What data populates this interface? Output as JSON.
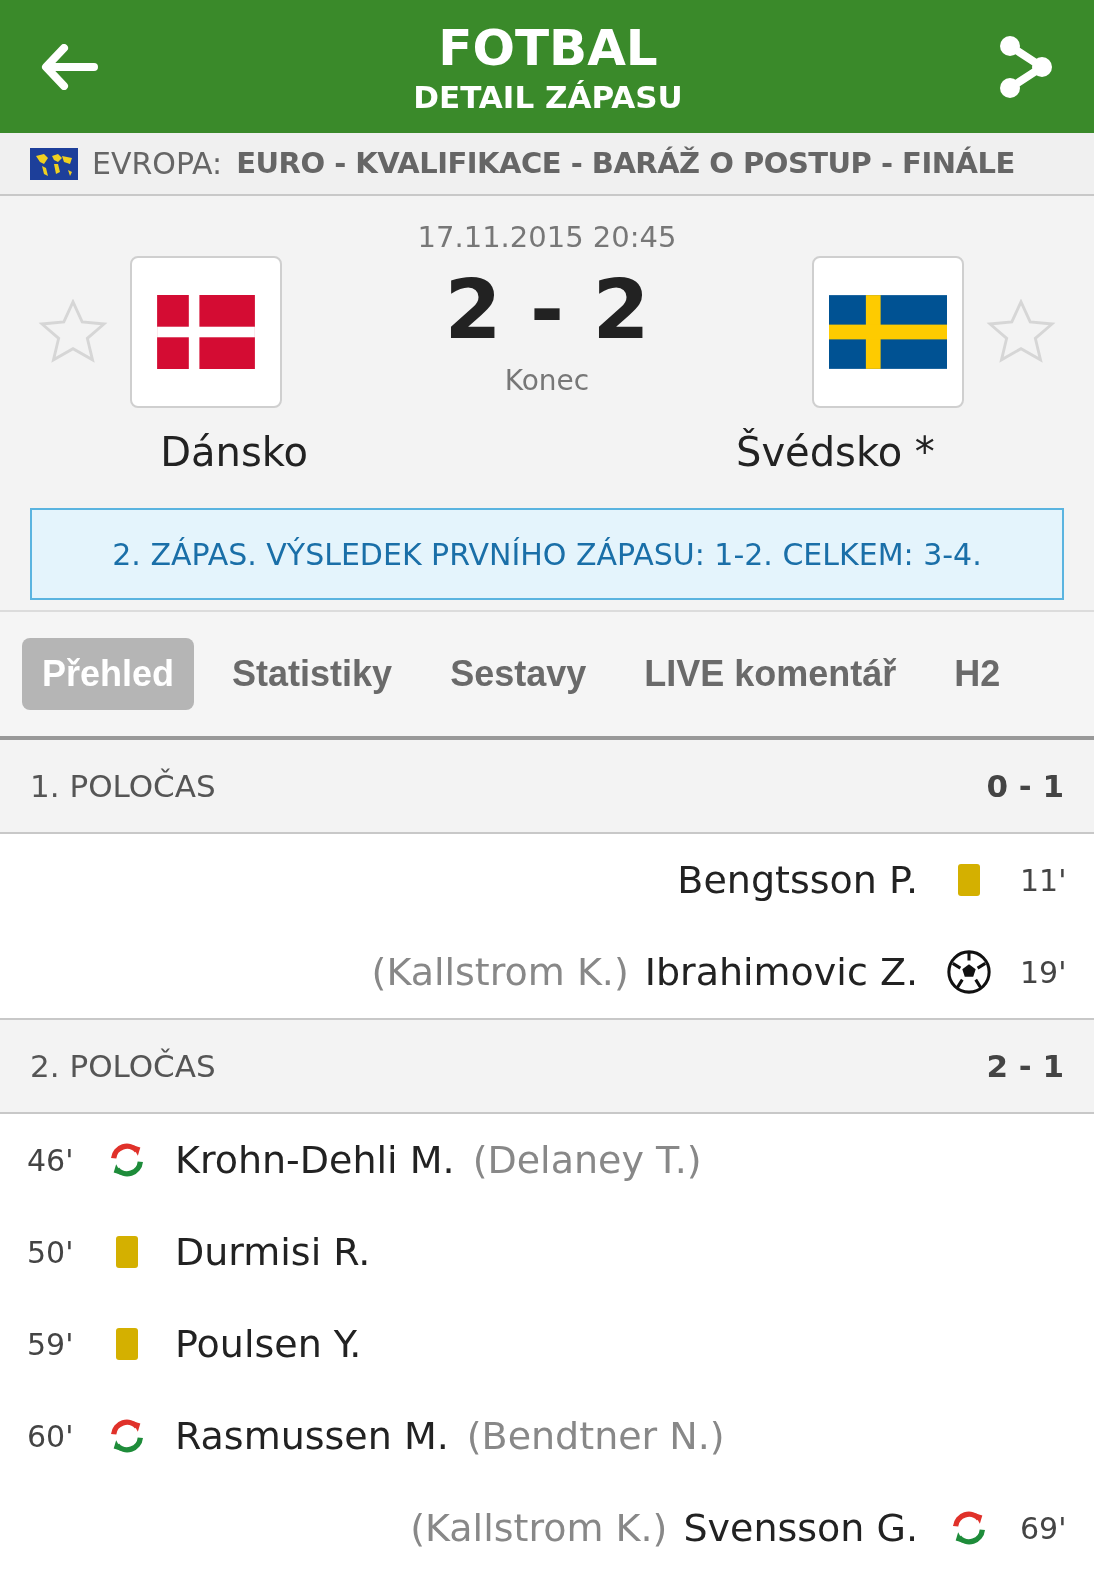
{
  "header": {
    "title": "FOTBAL",
    "subtitle": "DETAIL ZÁPASU"
  },
  "league": {
    "region": "EVROPA:",
    "name": "EURO - KVALIFIKACE - BARÁŽ O POSTUP - FINÁLE"
  },
  "match": {
    "datetime": "17.11.2015 20:45",
    "score": "2 - 2",
    "status": "Konec",
    "home": {
      "name": "Dánsko",
      "favorite": false,
      "logo": {
        "kind": "denmark"
      }
    },
    "away": {
      "name": "Švédsko *",
      "favorite": false,
      "logo": {
        "kind": "sweden"
      }
    },
    "info": "2. ZÁPAS. VÝSLEDEK PRVNÍHO ZÁPASU: 1-2. CELKEM: 3-4."
  },
  "tabs": [
    {
      "label": "Přehled",
      "selected": true
    },
    {
      "label": "Statistiky",
      "selected": false
    },
    {
      "label": "Sestavy",
      "selected": false
    },
    {
      "label": "LIVE komentář",
      "selected": false
    },
    {
      "label": "H2",
      "selected": false
    }
  ],
  "periods": [
    {
      "title": "1. POLOČAS",
      "score": "0 - 1",
      "events": [
        {
          "away": true,
          "kind": "yellow",
          "minute": "11'",
          "player": "Bengtsson P."
        },
        {
          "away": true,
          "kind": "goal",
          "minute": "19'",
          "player": "Ibrahimovic Z.",
          "detail": "(Kallstrom K.)"
        }
      ]
    },
    {
      "title": "2. POLOČAS",
      "score": "2 - 1",
      "events": [
        {
          "away": false,
          "kind": "sub",
          "minute": "46'",
          "player": "Krohn-Dehli M.",
          "detail": "(Delaney T.)"
        },
        {
          "away": false,
          "kind": "yellow",
          "minute": "50'",
          "player": "Durmisi R."
        },
        {
          "away": false,
          "kind": "yellow",
          "minute": "59'",
          "player": "Poulsen Y."
        },
        {
          "away": false,
          "kind": "sub",
          "minute": "60'",
          "player": "Rasmussen M.",
          "detail": "(Bendtner N.)"
        },
        {
          "away": true,
          "kind": "sub",
          "minute": "69'",
          "player": "Svensson G.",
          "detail": "(Kallstrom K.)"
        }
      ]
    }
  ]
}
